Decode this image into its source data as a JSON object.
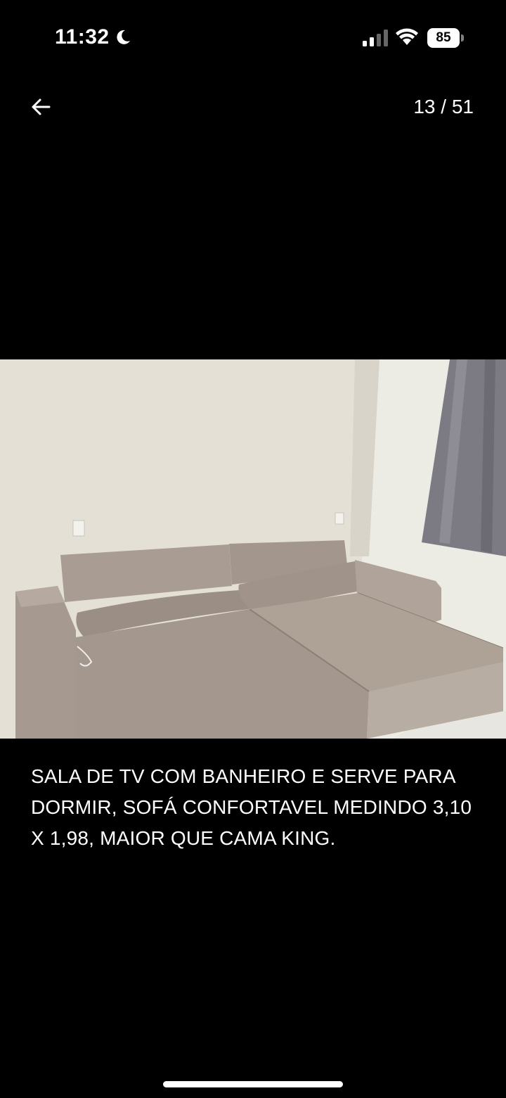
{
  "status_bar": {
    "time": "11:32",
    "battery_level": "85",
    "icons": [
      "moon-icon",
      "signal-icon",
      "wifi-icon",
      "battery-icon"
    ]
  },
  "nav": {
    "back_icon": "arrow-left-icon",
    "counter": "13 / 51"
  },
  "photo": {
    "subject": "sofa-room-photo",
    "colors": {
      "wall": "#e6e2d8",
      "sofa": "#a89b91",
      "curtain": "#7c7a82"
    }
  },
  "caption": {
    "text": "SALA DE TV COM BANHEIRO E SERVE PARA DORMIR, SOFÁ CONFORTAVEL MEDINDO 3,10 X 1,98, MAIOR QUE CAMA KING."
  }
}
